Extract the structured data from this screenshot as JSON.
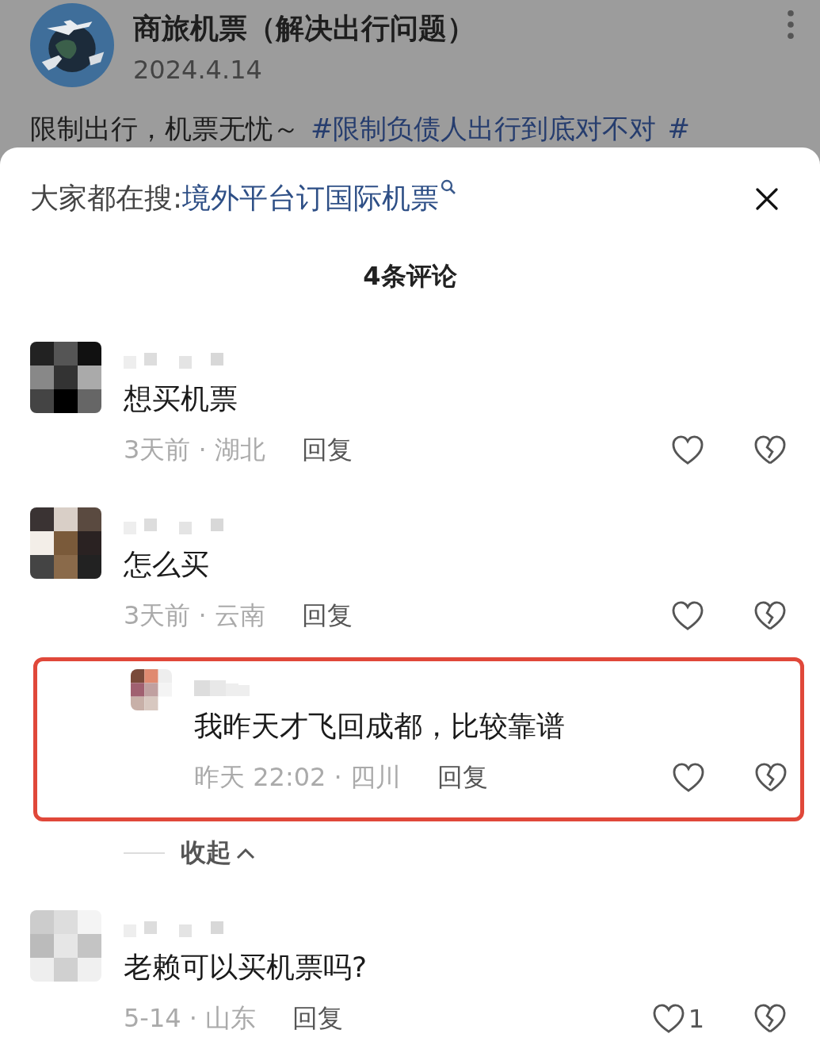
{
  "post": {
    "title": "商旅机票（解决出行问题）",
    "date": "2024.4.14",
    "text": "限制出行，机票无忧～",
    "hashtags": [
      "#限制负债人出行到底对不对",
      "#"
    ]
  },
  "search_suggest": {
    "label": "大家都在搜:",
    "query": "境外平台订国际机票"
  },
  "comment_count": "4条评论",
  "comments": [
    {
      "text": "想买机票",
      "meta": "3天前 · 湖北",
      "reply_label": "回复"
    },
    {
      "text": "怎么买",
      "meta": "3天前 · 云南",
      "reply_label": "回复",
      "replies": [
        {
          "text": "我昨天才飞回成都，比较靠谱",
          "meta": "昨天 22:02 · 四川",
          "reply_label": "回复",
          "highlighted": true
        }
      ],
      "collapse_label": "收起"
    },
    {
      "text": "老赖可以买机票吗?",
      "meta": "5-14 · 山东",
      "reply_label": "回复",
      "like_count": "1"
    }
  ]
}
